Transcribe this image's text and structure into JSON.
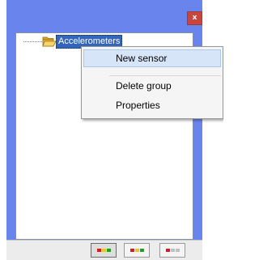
{
  "window": {
    "close_glyph": "x",
    "frame_color": "#6a84ee",
    "close_color": "#c9463d"
  },
  "tree": {
    "root": {
      "label": "Accelerometers",
      "icon": "folder-open-icon",
      "selected": true,
      "selection_color": "#3366bb"
    }
  },
  "context_menu": {
    "items": [
      {
        "label": "New sensor",
        "highlighted": true
      },
      {
        "label": "Delete group",
        "highlighted": false
      },
      {
        "label": "Properties",
        "highlighted": false
      }
    ],
    "highlight_color": "#d6e6f8"
  },
  "toolbar": {
    "buttons": [
      {
        "icon": "status-leds-icon",
        "pressed": true,
        "leds": [
          "#e01818",
          "#e8c81c",
          "#19a619"
        ]
      },
      {
        "icon": "status-leds-icon",
        "pressed": false,
        "leds": [
          "#e01818",
          "#e8c81c",
          "#19a619"
        ]
      },
      {
        "icon": "status-leds-icon",
        "pressed": false,
        "leds": [
          "#e01818",
          "#c0c0c0",
          "#c0c0c0"
        ]
      }
    ]
  }
}
